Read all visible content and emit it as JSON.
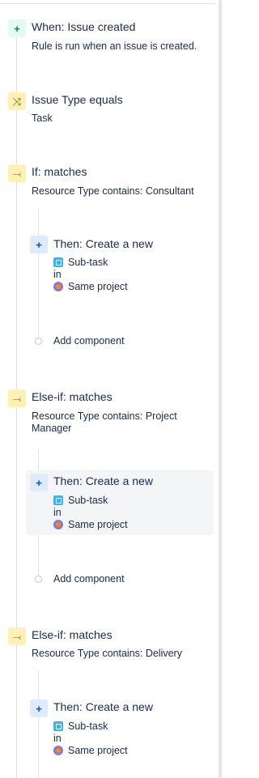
{
  "steps": {
    "trigger": {
      "icon": "plus-icon",
      "title": "When: Issue created",
      "desc": "Rule is run when an issue is created."
    },
    "condition": {
      "icon": "shuffle-icon",
      "title": "Issue Type equals",
      "desc": "Task"
    },
    "if_branch": {
      "icon": "branch-icon",
      "title": "If: matches",
      "desc": "Resource Type contains: Consultant"
    },
    "elseif_1": {
      "icon": "branch-icon",
      "title": "Else-if: matches",
      "desc": "Resource Type contains: Project Manager"
    },
    "elseif_2": {
      "icon": "branch-icon",
      "title": "Else-if: matches",
      "desc": "Resource Type contains: Delivery"
    }
  },
  "actions": {
    "action_1": {
      "icon": "plus-icon",
      "title": "Then: Create a new",
      "issue_type": "Sub-task",
      "in": "in",
      "project": "Same project"
    },
    "action_2": {
      "icon": "plus-icon",
      "title": "Then: Create a new",
      "issue_type": "Sub-task",
      "in": "in",
      "project": "Same project"
    },
    "action_3": {
      "icon": "plus-icon",
      "title": "Then: Create a new",
      "issue_type": "Sub-task",
      "in": "in",
      "project": "Same project"
    }
  },
  "add_component_label": "Add component",
  "glyphs": {
    "plus": "+",
    "shuffle": "⤨",
    "branch": "⤙"
  },
  "colors": {
    "trigger_bg": "#e3fcef",
    "condition_bg": "#fff0b3",
    "action_bg": "#deebff",
    "text": "#172b4d"
  }
}
